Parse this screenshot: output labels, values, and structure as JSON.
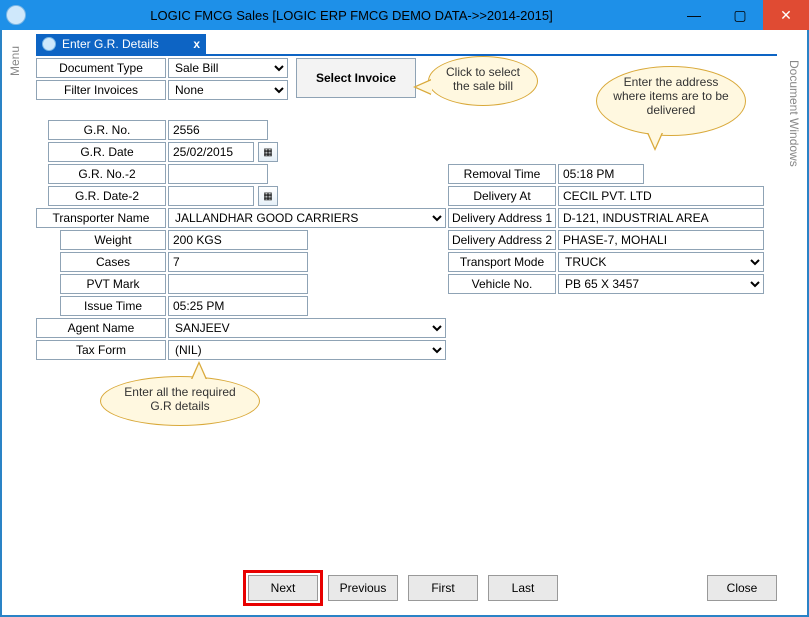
{
  "window": {
    "title": "LOGIC FMCG Sales  [LOGIC ERP FMCG DEMO DATA->>2014-2015]"
  },
  "sidetabs": {
    "left": "Menu",
    "right": "Document Windows"
  },
  "tab": {
    "title": "Enter G.R. Details",
    "close": "x"
  },
  "top": {
    "documentTypeLabel": "Document Type",
    "documentType": "Sale Bill",
    "filterInvoicesLabel": "Filter Invoices",
    "filterInvoices": "None",
    "selectInvoice": "Select Invoice"
  },
  "left": {
    "grNoLabel": "G.R. No.",
    "grNo": "2556",
    "grDateLabel": "G.R. Date",
    "grDate": "25/02/2015",
    "grNo2Label": "G.R. No.-2",
    "grNo2": "",
    "grDate2Label": "G.R. Date-2",
    "grDate2": "",
    "transporterLabel": "Transporter Name",
    "transporter": "JALLANDHAR GOOD CARRIERS",
    "weightLabel": "Weight",
    "weight": "200 KGS",
    "casesLabel": "Cases",
    "cases": "7",
    "pvtMarkLabel": "PVT Mark",
    "pvtMark": "",
    "issueTimeLabel": "Issue Time",
    "issueTime": "05:25 PM",
    "agentLabel": "Agent Name",
    "agent": "SANJEEV",
    "taxFormLabel": "Tax Form",
    "taxForm": "(NIL)"
  },
  "right": {
    "removalTimeLabel": "Removal Time",
    "removalTime": "05:18 PM",
    "deliveryAtLabel": "Delivery At",
    "deliveryAt": "CECIL PVT. LTD",
    "addr1Label": "Delivery Address 1",
    "addr1": "D-121, INDUSTRIAL AREA",
    "addr2Label": "Delivery Address 2",
    "addr2": "PHASE-7, MOHALI",
    "transportModeLabel": "Transport Mode",
    "transportMode": "TRUCK",
    "vehicleLabel": "Vehicle No.",
    "vehicle": "PB 65 X 3457"
  },
  "buttons": {
    "next": "Next",
    "previous": "Previous",
    "first": "First",
    "last": "Last",
    "close": "Close"
  },
  "callouts": {
    "c1": "Click to select the sale bill",
    "c2": "Enter the address where items are to be delivered",
    "c3": "Enter all the required G.R details"
  }
}
